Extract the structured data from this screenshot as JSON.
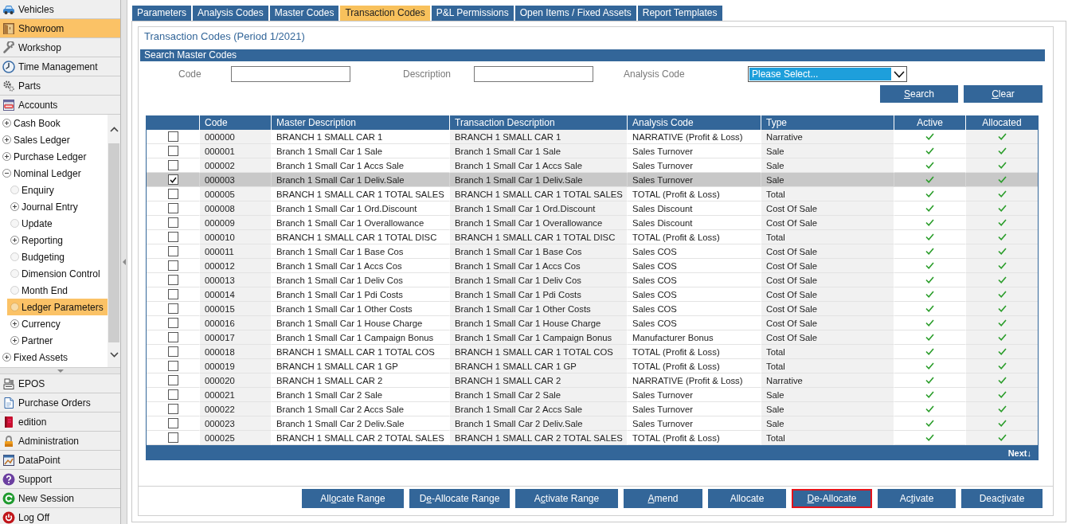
{
  "sidebar": {
    "top_items": [
      {
        "label": "Vehicles",
        "selected": false
      },
      {
        "label": "Showroom",
        "selected": true
      },
      {
        "label": "Workshop",
        "selected": false
      },
      {
        "label": "Time Management",
        "selected": false
      },
      {
        "label": "Parts",
        "selected": false
      },
      {
        "label": "Accounts",
        "selected": false
      }
    ],
    "tree": [
      {
        "label": "Cash Book",
        "kind": "branch",
        "expanded": false,
        "selected": false
      },
      {
        "label": "Sales Ledger",
        "kind": "branch",
        "expanded": false,
        "selected": false
      },
      {
        "label": "Purchase Ledger",
        "kind": "branch",
        "expanded": false,
        "selected": false
      },
      {
        "label": "Nominal Ledger",
        "kind": "branch",
        "expanded": true,
        "selected": false,
        "children": [
          {
            "label": "Enquiry",
            "kind": "leaf",
            "selected": false
          },
          {
            "label": "Journal Entry",
            "kind": "branch",
            "expanded": false,
            "selected": false
          },
          {
            "label": "Update",
            "kind": "leaf",
            "selected": false
          },
          {
            "label": "Reporting",
            "kind": "branch",
            "expanded": false,
            "selected": false
          },
          {
            "label": "Budgeting",
            "kind": "leaf",
            "selected": false
          },
          {
            "label": "Dimension Control",
            "kind": "leaf",
            "selected": false
          },
          {
            "label": "Month End",
            "kind": "leaf",
            "selected": false
          },
          {
            "label": "Ledger Parameters",
            "kind": "leaf",
            "selected": true
          },
          {
            "label": "Currency",
            "kind": "branch",
            "expanded": false,
            "selected": false
          },
          {
            "label": "Partner",
            "kind": "branch",
            "expanded": false,
            "selected": false
          }
        ]
      },
      {
        "label": "Fixed Assets",
        "kind": "branch",
        "expanded": false,
        "selected": false
      }
    ],
    "bottom_items": [
      {
        "label": "EPOS",
        "selected": false
      },
      {
        "label": "Purchase Orders",
        "selected": false
      },
      {
        "label": "edition",
        "selected": false
      },
      {
        "label": "Administration",
        "selected": false
      },
      {
        "label": "DataPoint",
        "selected": false
      },
      {
        "label": "Support",
        "selected": false
      },
      {
        "label": "New Session",
        "selected": false
      },
      {
        "label": "Log Off",
        "selected": false
      }
    ]
  },
  "tabs": [
    {
      "label": "Parameters",
      "selected": false
    },
    {
      "label": "Analysis Codes",
      "selected": false
    },
    {
      "label": "Master Codes",
      "selected": false
    },
    {
      "label": "Transaction Codes",
      "selected": true
    },
    {
      "label": "P&L Permissions",
      "selected": false
    },
    {
      "label": "Open Items / Fixed Assets",
      "selected": false
    },
    {
      "label": "Report Templates",
      "selected": false
    }
  ],
  "page_title": "Transaction Codes (Period 1/2021)",
  "search": {
    "header": "Search Master Codes",
    "fields": [
      {
        "label": "Code",
        "kind": "text",
        "focused": false
      },
      {
        "label": "Description",
        "kind": "text",
        "focused": false
      },
      {
        "label": "Analysis Code",
        "kind": "select",
        "value": "Please Select...",
        "focused": true
      }
    ],
    "buttons": [
      {
        "key": "S",
        "after": "earch"
      },
      {
        "key": "C",
        "after": "lear"
      }
    ]
  },
  "table": {
    "columns": [
      "Code",
      "Master Description",
      "Transaction Description",
      "Analysis Code",
      "Type",
      "Active",
      "Allocated"
    ],
    "rows": [
      {
        "checked": false,
        "selected": false,
        "code": "000000",
        "master_description": "BRANCH 1 SMALL CAR 1",
        "transaction_description": "BRANCH 1 SMALL CAR 1",
        "analysis_code": "NARRATIVE (Profit & Loss)",
        "type": "Narrative",
        "active": true,
        "allocated": true
      },
      {
        "checked": false,
        "selected": false,
        "code": "000001",
        "master_description": "Branch 1 Small Car 1 Sale",
        "transaction_description": "Branch 1 Small Car 1 Sale",
        "analysis_code": "Sales Turnover",
        "type": "Sale",
        "active": true,
        "allocated": true
      },
      {
        "checked": false,
        "selected": false,
        "code": "000002",
        "master_description": "Branch 1 Small Car 1 Accs Sale",
        "transaction_description": "Branch 1 Small Car 1 Accs Sale",
        "analysis_code": "Sales Turnover",
        "type": "Sale",
        "active": true,
        "allocated": true
      },
      {
        "checked": true,
        "selected": true,
        "code": "000003",
        "master_description": "Branch 1 Small Car 1 Deliv.Sale",
        "transaction_description": "Branch 1 Small Car 1 Deliv.Sale",
        "analysis_code": "Sales Turnover",
        "type": "Sale",
        "active": true,
        "allocated": true
      },
      {
        "checked": false,
        "selected": false,
        "code": "000005",
        "master_description": "BRANCH 1 SMALL CAR 1 TOTAL SALES",
        "transaction_description": "BRANCH 1 SMALL CAR 1 TOTAL SALES",
        "analysis_code": "TOTAL (Profit & Loss)",
        "type": "Total",
        "active": true,
        "allocated": true
      },
      {
        "checked": false,
        "selected": false,
        "code": "000008",
        "master_description": "Branch 1 Small Car 1 Ord.Discount",
        "transaction_description": "Branch 1 Small Car 1 Ord.Discount",
        "analysis_code": "Sales Discount",
        "type": "Cost Of Sale",
        "active": true,
        "allocated": true
      },
      {
        "checked": false,
        "selected": false,
        "code": "000009",
        "master_description": "Branch 1 Small Car 1 Overallowance",
        "transaction_description": "Branch 1 Small Car 1 Overallowance",
        "analysis_code": "Sales Discount",
        "type": "Cost Of Sale",
        "active": true,
        "allocated": true
      },
      {
        "checked": false,
        "selected": false,
        "code": "000010",
        "master_description": "BRANCH 1 SMALL CAR 1 TOTAL DISC",
        "transaction_description": "BRANCH 1 SMALL CAR 1 TOTAL DISC",
        "analysis_code": "TOTAL (Profit & Loss)",
        "type": "Total",
        "active": true,
        "allocated": true
      },
      {
        "checked": false,
        "selected": false,
        "code": "000011",
        "master_description": "Branch 1 Small Car 1 Base Cos",
        "transaction_description": "Branch 1 Small Car 1 Base Cos",
        "analysis_code": "Sales COS",
        "type": "Cost Of Sale",
        "active": true,
        "allocated": true
      },
      {
        "checked": false,
        "selected": false,
        "code": "000012",
        "master_description": "Branch 1 Small Car 1 Accs Cos",
        "transaction_description": "Branch 1 Small Car 1 Accs Cos",
        "analysis_code": "Sales COS",
        "type": "Cost Of Sale",
        "active": true,
        "allocated": true
      },
      {
        "checked": false,
        "selected": false,
        "code": "000013",
        "master_description": "Branch 1 Small Car 1 Deliv Cos",
        "transaction_description": "Branch 1 Small Car 1 Deliv Cos",
        "analysis_code": "Sales COS",
        "type": "Cost Of Sale",
        "active": true,
        "allocated": true
      },
      {
        "checked": false,
        "selected": false,
        "code": "000014",
        "master_description": "Branch 1 Small Car 1 Pdi Costs",
        "transaction_description": "Branch 1 Small Car 1 Pdi Costs",
        "analysis_code": "Sales COS",
        "type": "Cost Of Sale",
        "active": true,
        "allocated": true
      },
      {
        "checked": false,
        "selected": false,
        "code": "000015",
        "master_description": "Branch 1 Small Car 1 Other Costs",
        "transaction_description": "Branch 1 Small Car 1 Other Costs",
        "analysis_code": "Sales COS",
        "type": "Cost Of Sale",
        "active": true,
        "allocated": true
      },
      {
        "checked": false,
        "selected": false,
        "code": "000016",
        "master_description": "Branch 1 Small Car 1 House Charge",
        "transaction_description": "Branch 1 Small Car 1 House Charge",
        "analysis_code": "Sales COS",
        "type": "Cost Of Sale",
        "active": true,
        "allocated": true
      },
      {
        "checked": false,
        "selected": false,
        "code": "000017",
        "master_description": "Branch 1 Small Car 1 Campaign Bonus",
        "transaction_description": "Branch 1 Small Car 1 Campaign Bonus",
        "analysis_code": "Manufacturer Bonus",
        "type": "Cost Of Sale",
        "active": true,
        "allocated": true
      },
      {
        "checked": false,
        "selected": false,
        "code": "000018",
        "master_description": "BRANCH 1 SMALL CAR 1 TOTAL COS",
        "transaction_description": "BRANCH 1 SMALL CAR 1 TOTAL COS",
        "analysis_code": "TOTAL (Profit & Loss)",
        "type": "Total",
        "active": true,
        "allocated": true
      },
      {
        "checked": false,
        "selected": false,
        "code": "000019",
        "master_description": "BRANCH 1 SMALL CAR 1 GP",
        "transaction_description": "BRANCH 1 SMALL CAR 1 GP",
        "analysis_code": "TOTAL (Profit & Loss)",
        "type": "Total",
        "active": true,
        "allocated": true
      },
      {
        "checked": false,
        "selected": false,
        "code": "000020",
        "master_description": "BRANCH 1 SMALL CAR 2",
        "transaction_description": "BRANCH 1 SMALL CAR 2",
        "analysis_code": "NARRATIVE (Profit & Loss)",
        "type": "Narrative",
        "active": true,
        "allocated": true
      },
      {
        "checked": false,
        "selected": false,
        "code": "000021",
        "master_description": "Branch 1 Small Car 2 Sale",
        "transaction_description": "Branch 1 Small Car 2 Sale",
        "analysis_code": "Sales Turnover",
        "type": "Sale",
        "active": true,
        "allocated": true
      },
      {
        "checked": false,
        "selected": false,
        "code": "000022",
        "master_description": "Branch 1 Small Car 2 Accs Sale",
        "transaction_description": "Branch 1 Small Car 2 Accs Sale",
        "analysis_code": "Sales Turnover",
        "type": "Sale",
        "active": true,
        "allocated": true
      },
      {
        "checked": false,
        "selected": false,
        "code": "000023",
        "master_description": "Branch 1 Small Car 2 Deliv.Sale",
        "transaction_description": "Branch 1 Small Car 2 Deliv.Sale",
        "analysis_code": "Sales Turnover",
        "type": "Sale",
        "active": true,
        "allocated": true
      },
      {
        "checked": false,
        "selected": false,
        "code": "000025",
        "master_description": "BRANCH 1 SMALL CAR 2 TOTAL SALES",
        "transaction_description": "BRANCH 1 SMALL CAR 2 TOTAL SALES",
        "analysis_code": "TOTAL (Profit & Loss)",
        "type": "Total",
        "active": true,
        "allocated": true
      }
    ],
    "footer_link": "Next↓"
  },
  "actions": [
    {
      "before": "All",
      "key": "o",
      "after": "cate Range",
      "focused": false
    },
    {
      "before": "D",
      "key": "e",
      "after": "-Allocate Range",
      "focused": false
    },
    {
      "before": "A",
      "key": "c",
      "after": "tivate Range",
      "focused": false
    },
    {
      "key": "A",
      "after": "mend",
      "focused": false
    },
    {
      "before": "Allocate",
      "focused": false
    },
    {
      "key": "D",
      "after": "e-Allocate",
      "focused": true
    },
    {
      "before": "Ac",
      "key": "t",
      "after": "ivate",
      "focused": false
    },
    {
      "before": "Deac",
      "key": "t",
      "after": "ivate",
      "focused": false
    }
  ]
}
